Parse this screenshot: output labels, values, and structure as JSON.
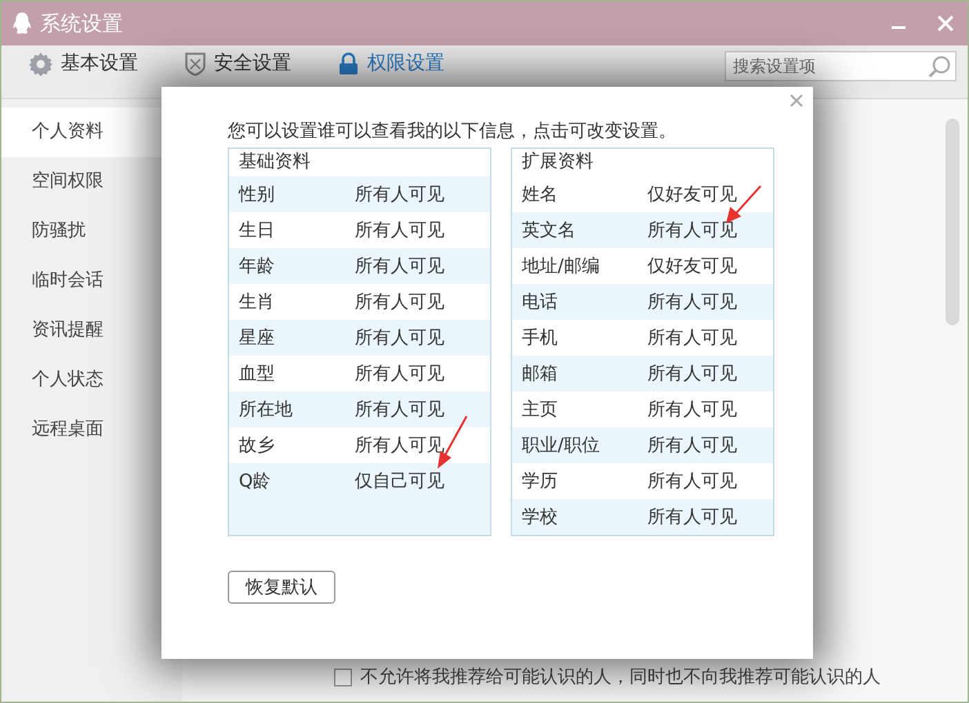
{
  "window": {
    "title": "系统设置"
  },
  "tabs": [
    {
      "label": "基本设置",
      "kind": "gear",
      "selected": false
    },
    {
      "label": "安全设置",
      "kind": "shield",
      "selected": false
    },
    {
      "label": "权限设置",
      "kind": "lock",
      "selected": true
    }
  ],
  "search": {
    "placeholder": "搜索设置项"
  },
  "sidebar": {
    "items": [
      {
        "label": "个人资料",
        "selected": true
      },
      {
        "label": "空间权限",
        "selected": false
      },
      {
        "label": "防骚扰",
        "selected": false
      },
      {
        "label": "临时会话",
        "selected": false
      },
      {
        "label": "资讯提醒",
        "selected": false
      },
      {
        "label": "个人状态",
        "selected": false
      },
      {
        "label": "远程桌面",
        "selected": false
      }
    ]
  },
  "dialog": {
    "instruction": "您可以设置谁可以查看我的以下信息，点击可改变设置。",
    "tables": [
      {
        "title": "基础资料",
        "first_row_shaded": true,
        "rows": [
          {
            "field": "性别",
            "visibility": "所有人可见"
          },
          {
            "field": "生日",
            "visibility": "所有人可见"
          },
          {
            "field": "年龄",
            "visibility": "所有人可见"
          },
          {
            "field": "生肖",
            "visibility": "所有人可见"
          },
          {
            "field": "星座",
            "visibility": "所有人可见"
          },
          {
            "field": "血型",
            "visibility": "所有人可见"
          },
          {
            "field": "所在地",
            "visibility": "所有人可见"
          },
          {
            "field": "故乡",
            "visibility": "所有人可见"
          },
          {
            "field": "Q龄",
            "visibility": "仅自己可见"
          }
        ]
      },
      {
        "title": "扩展资料",
        "first_row_shaded": false,
        "rows": [
          {
            "field": "姓名",
            "visibility": "仅好友可见"
          },
          {
            "field": "英文名",
            "visibility": "所有人可见"
          },
          {
            "field": "地址/邮编",
            "visibility": "仅好友可见"
          },
          {
            "field": "电话",
            "visibility": "所有人可见"
          },
          {
            "field": "手机",
            "visibility": "所有人可见"
          },
          {
            "field": "邮箱",
            "visibility": "所有人可见"
          },
          {
            "field": "主页",
            "visibility": "所有人可见"
          },
          {
            "field": "职业/职位",
            "visibility": "所有人可见"
          },
          {
            "field": "学历",
            "visibility": "所有人可见"
          },
          {
            "field": "学校",
            "visibility": "所有人可见"
          }
        ]
      }
    ],
    "buttons": [
      "恢复默认"
    ]
  },
  "footer": {
    "checkbox": {
      "label": "不允许将我推荐给可能认识的人，同时也不向我推荐可能认识的人",
      "checked": false
    }
  }
}
